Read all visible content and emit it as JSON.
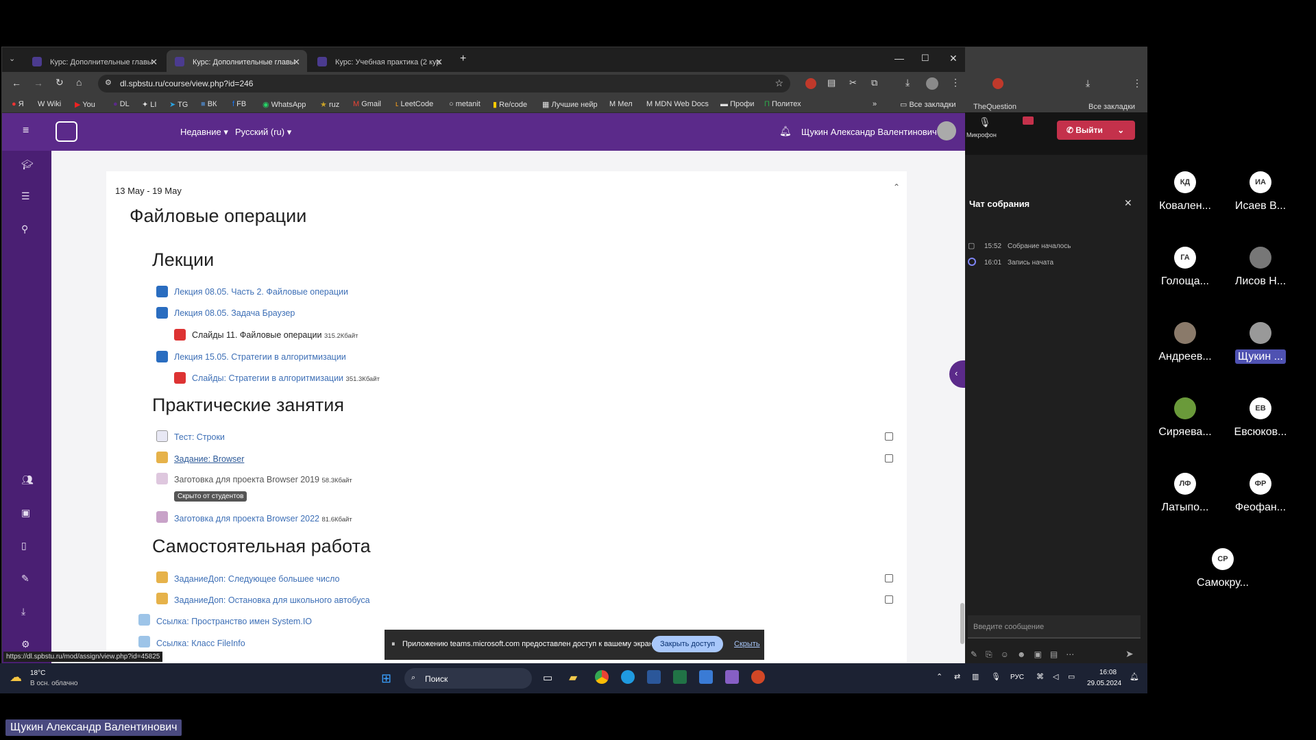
{
  "browser": {
    "tabs": [
      {
        "label": "Курс: Дополнительные главы"
      },
      {
        "label": "Курс: Дополнительные главы"
      },
      {
        "label": "Курс: Учебная практика (2 кур"
      }
    ],
    "url": "dl.spbstu.ru/course/view.php?id=246",
    "bookmarks": [
      "Я",
      "Wiki",
      "You",
      "DL",
      "LI",
      "TG",
      "ВК",
      "FB",
      "WhatsApp",
      "ruz",
      "Gmail",
      "LeetCode",
      "metanit",
      "Re/code",
      "Лучшие нейр",
      "Мел",
      "MDN Web Docs",
      "Профи",
      "Политех"
    ],
    "all_bookmarks": "Все закладки",
    "status_url": "https://dl.spbstu.ru/mod/assign/view.php?id=45825"
  },
  "moodle": {
    "nav_recent": "Недавние",
    "nav_lang": "Русский (ru)",
    "user_name": "Щукин Александр Валентинович",
    "section_dates": "13 May - 19 May",
    "section_title": "Файловые операции",
    "lectures_heading": "Лекции",
    "lectures": [
      {
        "label": "Лекция 08.05. Часть 2. Файловые операции"
      },
      {
        "label": "Лекция 08.05. Задача Браузер"
      },
      {
        "label": "Слайды 11. Файловые операции",
        "size": "315.2Кбайт"
      },
      {
        "label": "Лекция 15.05. Стратегии в алгоритмизации"
      },
      {
        "label": "Слайды: Стратегии в алгоритмизации",
        "size": "351.3Кбайт"
      }
    ],
    "practice_heading": "Практические занятия",
    "practice": [
      {
        "label": "Тест: Строки"
      },
      {
        "label": "Задание: Browser"
      },
      {
        "label": "Заготовка для проекта Browser 2019",
        "size": "58.3Кбайт"
      },
      {
        "label": "Скрыто от студентов"
      },
      {
        "label": "Заготовка для проекта Browser 2022",
        "size": "81.6Кбайт"
      }
    ],
    "self_heading": "Самостоятельная работа",
    "self": [
      {
        "label": "ЗаданиеДоп: Следующее большее число"
      },
      {
        "label": "ЗаданиеДоп: Остановка для школьного автобуса"
      },
      {
        "label": "Ссылка: Пространство имен System.IO"
      },
      {
        "label": "Ссылка: Класс FileInfo"
      }
    ],
    "share_notice": "Приложению teams.microsoft.com предоставлен доступ к вашему экрану.",
    "share_stop": "Закрыть доступ",
    "share_hide": "Скрыть"
  },
  "teams": {
    "mic_label": "Микрофон",
    "leave_label": "Выйти",
    "chat_title": "Чат собрания",
    "bookmarks_item": "TheQuestion",
    "all_bookmarks": "Все закладки",
    "events": [
      {
        "time": "15:52",
        "text": "Собрание началось"
      },
      {
        "time": "16:01",
        "text": "Запись начата"
      }
    ],
    "input_placeholder": "Введите сообщение"
  },
  "participants": [
    {
      "initials": "КД",
      "name": "Ковален..."
    },
    {
      "initials": "ИА",
      "name": "Исаев В..."
    },
    {
      "initials": "ГА",
      "name": "Голоща..."
    },
    {
      "initials": "",
      "name": "Лисов Н..."
    },
    {
      "initials": "",
      "name": "Андреев..."
    },
    {
      "initials": "",
      "name": "Щукин ..."
    },
    {
      "initials": "",
      "name": "Сиряева..."
    },
    {
      "initials": "ЕВ",
      "name": "Евсюков..."
    },
    {
      "initials": "ЛФ",
      "name": "Латыпо..."
    },
    {
      "initials": "ФР",
      "name": "Феофан..."
    },
    {
      "initials": "СР",
      "name": "Самокру..."
    }
  ],
  "taskbar": {
    "temp": "18°C",
    "weather": "В осн. облачно",
    "search": "Поиск",
    "lang": "РУС",
    "time": "16:08",
    "date": "29.05.2024"
  },
  "speaker_name": "Щукин Александр Валентинович"
}
